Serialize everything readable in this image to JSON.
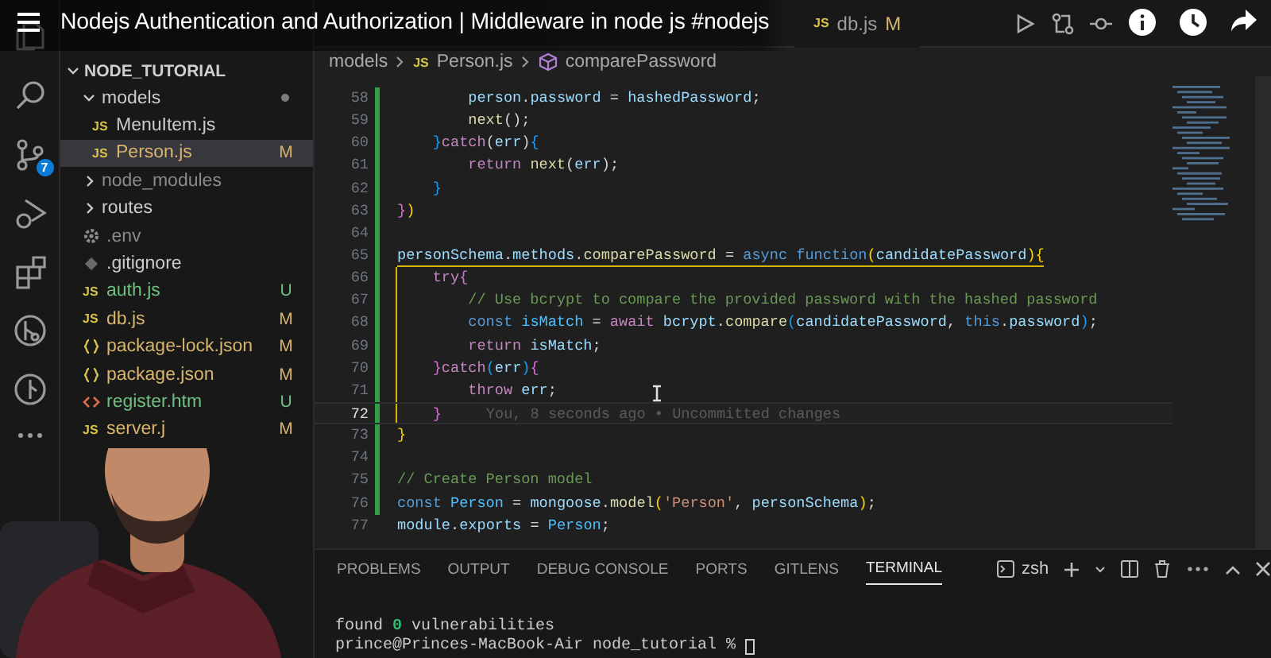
{
  "video_title": "Nodejs Authentication and Authorization | Middleware in node js #nodejs",
  "activity_bar": {
    "source_control_badge": "7"
  },
  "explorer": {
    "root": "NODE_TUTORIAL",
    "items": [
      {
        "name": "models",
        "kind": "folder",
        "expanded": true,
        "selected": false,
        "ignored": false,
        "dot": true,
        "children": [
          {
            "name": "MenuItem.js",
            "kind": "js",
            "badge": "JS",
            "selected": false,
            "ignored": false
          },
          {
            "name": "Person.js",
            "kind": "js",
            "badge": "JS",
            "status": "M",
            "selected": true,
            "ignored": false
          }
        ]
      },
      {
        "name": "node_modules",
        "kind": "folder",
        "expanded": false,
        "selected": false,
        "ignored": true,
        "dot": false
      },
      {
        "name": "routes",
        "kind": "folder",
        "expanded": false,
        "selected": false,
        "ignored": false,
        "dot": false
      },
      {
        "name": ".env",
        "kind": "env",
        "selected": false,
        "ignored": true
      },
      {
        "name": ".gitignore",
        "kind": "git",
        "selected": false,
        "ignored": false
      },
      {
        "name": "auth.js",
        "kind": "js",
        "badge": "JS",
        "status": "U",
        "selected": false,
        "ignored": false
      },
      {
        "name": "db.js",
        "kind": "js",
        "badge": "JS",
        "status": "M",
        "selected": false,
        "ignored": false
      },
      {
        "name": "package-lock.json",
        "kind": "json",
        "status": "M",
        "selected": false,
        "ignored": false
      },
      {
        "name": "package.json",
        "kind": "json",
        "status": "M",
        "selected": false,
        "ignored": false
      },
      {
        "name": "register.htm",
        "kind": "html",
        "status": "U",
        "selected": false,
        "ignored": false
      },
      {
        "name": "server.j",
        "kind": "js",
        "badge": "JS",
        "status": "M",
        "selected": false,
        "ignored": false
      }
    ]
  },
  "tabs": [
    {
      "label": "db.js",
      "badge": "JS",
      "status": "M",
      "selected": false
    }
  ],
  "breadcrumb": {
    "folder": "models",
    "badge": "JS",
    "file": "Person.js",
    "symbol": "comparePassword"
  },
  "lines": [
    {
      "number": "58",
      "kind": "plain",
      "current": false,
      "modified": true,
      "tokens": [
        {
          "kind": "var",
          "t": "        person"
        },
        {
          "kind": "p",
          "t": "."
        },
        {
          "kind": "var",
          "t": "password"
        },
        {
          "kind": "p",
          "t": " = "
        },
        {
          "kind": "var",
          "t": "hashedPassword"
        },
        {
          "kind": "p",
          "t": ";"
        }
      ]
    },
    {
      "number": "59",
      "kind": "plain",
      "current": false,
      "modified": true,
      "tokens": [
        {
          "kind": "fn",
          "t": "        next"
        },
        {
          "kind": "p",
          "t": "();"
        }
      ]
    },
    {
      "number": "60",
      "kind": "plain",
      "current": false,
      "modified": true,
      "tokens": [
        {
          "kind": "b3",
          "t": "    }"
        },
        {
          "kind": "kw",
          "t": "catch"
        },
        {
          "kind": "p",
          "t": "("
        },
        {
          "kind": "var",
          "t": "err"
        },
        {
          "kind": "p",
          "t": ")"
        },
        {
          "kind": "b3",
          "t": "{"
        }
      ]
    },
    {
      "number": "61",
      "kind": "plain",
      "current": false,
      "modified": true,
      "tokens": [
        {
          "kind": "kw",
          "t": "        return "
        },
        {
          "kind": "fn",
          "t": "next"
        },
        {
          "kind": "p",
          "t": "("
        },
        {
          "kind": "var",
          "t": "err"
        },
        {
          "kind": "p",
          "t": ");"
        }
      ]
    },
    {
      "number": "62",
      "kind": "plain",
      "current": false,
      "modified": true,
      "tokens": [
        {
          "kind": "b3",
          "t": "    }"
        }
      ]
    },
    {
      "number": "63",
      "kind": "plain",
      "current": false,
      "modified": true,
      "tokens": [
        {
          "kind": "b2",
          "t": "}"
        },
        {
          "kind": "b1",
          "t": ")"
        }
      ]
    },
    {
      "number": "64",
      "kind": "plain",
      "current": false,
      "modified": true
    },
    {
      "number": "65",
      "kind": "scope_head",
      "current": false,
      "modified": true,
      "tokens": [
        {
          "kind": "var",
          "t": "personSchema"
        },
        {
          "kind": "p",
          "t": "."
        },
        {
          "kind": "var",
          "t": "methods"
        },
        {
          "kind": "p",
          "t": "."
        },
        {
          "kind": "fn",
          "t": "comparePassword"
        },
        {
          "kind": "p",
          "t": " = "
        },
        {
          "kind": "sto",
          "t": "async "
        },
        {
          "kind": "sto",
          "t": "function"
        },
        {
          "kind": "b1",
          "t": "("
        },
        {
          "kind": "var",
          "t": "candidatePassword"
        },
        {
          "kind": "b1",
          "t": ")"
        },
        {
          "kind": "b1",
          "t": "{"
        }
      ]
    },
    {
      "number": "66",
      "kind": "scope_body",
      "current": false,
      "modified": true,
      "tokens": [
        {
          "kind": "kw",
          "t": "    try"
        },
        {
          "kind": "b2",
          "t": "{"
        }
      ]
    },
    {
      "number": "67",
      "kind": "scope_body",
      "current": false,
      "modified": true,
      "tokens": [
        {
          "kind": "cmt",
          "t": "        // Use bcrypt to compare the provided password with the hashed password"
        }
      ]
    },
    {
      "number": "68",
      "kind": "scope_body",
      "current": false,
      "modified": true,
      "tokens": [
        {
          "kind": "sto",
          "t": "        const "
        },
        {
          "kind": "const",
          "t": "isMatch"
        },
        {
          "kind": "p",
          "t": " = "
        },
        {
          "kind": "kw",
          "t": "await "
        },
        {
          "kind": "var",
          "t": "bcrypt"
        },
        {
          "kind": "p",
          "t": "."
        },
        {
          "kind": "fn",
          "t": "compare"
        },
        {
          "kind": "b3",
          "t": "("
        },
        {
          "kind": "var",
          "t": "candidatePassword"
        },
        {
          "kind": "p",
          "t": ", "
        },
        {
          "kind": "sto",
          "t": "this"
        },
        {
          "kind": "p",
          "t": "."
        },
        {
          "kind": "var",
          "t": "password"
        },
        {
          "kind": "b3",
          "t": ")"
        },
        {
          "kind": "p",
          "t": ";"
        }
      ]
    },
    {
      "number": "69",
      "kind": "scope_body",
      "current": false,
      "modified": true,
      "tokens": [
        {
          "kind": "kw",
          "t": "        return "
        },
        {
          "kind": "var",
          "t": "isMatch"
        },
        {
          "kind": "p",
          "t": ";"
        }
      ]
    },
    {
      "number": "70",
      "kind": "scope_body",
      "current": false,
      "modified": true,
      "tokens": [
        {
          "kind": "b2",
          "t": "    }"
        },
        {
          "kind": "kw",
          "t": "catch"
        },
        {
          "kind": "b3",
          "t": "("
        },
        {
          "kind": "var",
          "t": "err"
        },
        {
          "kind": "b3",
          "t": ")"
        },
        {
          "kind": "b2",
          "t": "{"
        }
      ]
    },
    {
      "number": "71",
      "kind": "scope_body",
      "current": false,
      "modified": true,
      "tokens": [
        {
          "kind": "kw",
          "t": "        throw "
        },
        {
          "kind": "var",
          "t": "err"
        },
        {
          "kind": "p",
          "t": ";"
        }
      ]
    },
    {
      "number": "72",
      "kind": "scope_body",
      "current": true,
      "modified": true,
      "blame": "You, 8 seconds ago • Uncommitted changes",
      "tokens": [
        {
          "kind": "b2",
          "t": "    }"
        }
      ]
    },
    {
      "number": "73",
      "kind": "plain",
      "current": false,
      "modified": true,
      "tokens": [
        {
          "kind": "b1",
          "t": "}"
        }
      ]
    },
    {
      "number": "74",
      "kind": "plain",
      "current": false,
      "modified": true
    },
    {
      "number": "75",
      "kind": "plain",
      "current": false,
      "modified": true,
      "tokens": [
        {
          "kind": "cmt",
          "t": "// Create Person model"
        }
      ]
    },
    {
      "number": "76",
      "kind": "plain",
      "current": false,
      "modified": true,
      "tokens": [
        {
          "kind": "sto",
          "t": "const "
        },
        {
          "kind": "const",
          "t": "Person"
        },
        {
          "kind": "p",
          "t": " = "
        },
        {
          "kind": "var",
          "t": "mongoose"
        },
        {
          "kind": "p",
          "t": "."
        },
        {
          "kind": "fn",
          "t": "model"
        },
        {
          "kind": "b1",
          "t": "("
        },
        {
          "kind": "str",
          "t": "'Person'"
        },
        {
          "kind": "p",
          "t": ", "
        },
        {
          "kind": "var",
          "t": "personSchema"
        },
        {
          "kind": "b1",
          "t": ")"
        },
        {
          "kind": "p",
          "t": ";"
        }
      ]
    },
    {
      "number": "77",
      "kind": "plain",
      "current": false,
      "modified": false,
      "tokens": [
        {
          "kind": "var",
          "t": "module"
        },
        {
          "kind": "p",
          "t": "."
        },
        {
          "kind": "var",
          "t": "exports"
        },
        {
          "kind": "p",
          "t": " = "
        },
        {
          "kind": "const",
          "t": "Person"
        },
        {
          "kind": "p",
          "t": ";"
        }
      ]
    }
  ],
  "panel": {
    "tabs": [
      {
        "label": "PROBLEMS",
        "selected": false
      },
      {
        "label": "OUTPUT",
        "selected": false
      },
      {
        "label": "DEBUG CONSOLE",
        "selected": false
      },
      {
        "label": "PORTS",
        "selected": false
      },
      {
        "label": "GITLENS",
        "selected": false
      },
      {
        "label": "TERMINAL",
        "selected": true
      }
    ],
    "shell": "zsh",
    "terminal_lines": [
      "found **0** vulnerabilities",
      "prince@Princes-MacBook-Air node_tutorial %"
    ]
  }
}
